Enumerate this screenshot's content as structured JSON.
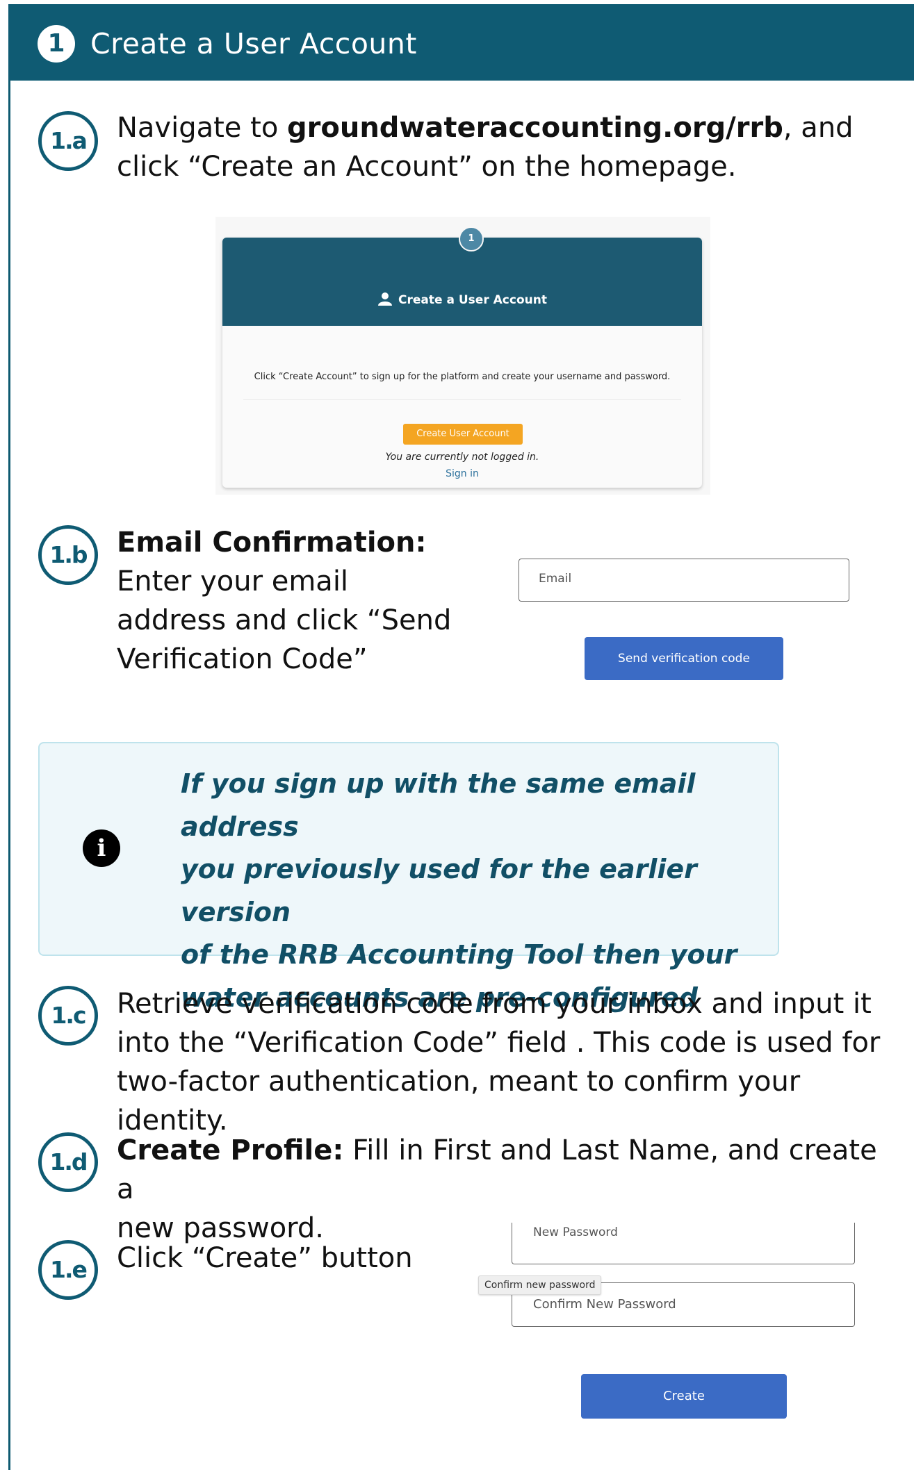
{
  "header": {
    "step_number": "1",
    "title": "Create a User Account"
  },
  "steps": {
    "a": {
      "badge": "1.a",
      "text_pre": "Navigate to ",
      "url": "groundwateraccounting.org/rrb",
      "text_post": ", and click “Create an Account” on the homepage."
    },
    "b": {
      "badge": "1.b",
      "heading": "Email Confirmation:",
      "line1": "Enter your email",
      "line2": "address and click “Send",
      "line3": "Verification Code”"
    },
    "c": {
      "badge": "1.c",
      "line1": "Retrieve verification code from your inbox and input it",
      "line2": "into the “Verification Code” field . This code is used for",
      "line3": "two-factor authentication, meant to confirm your identity."
    },
    "d": {
      "badge": "1.d",
      "heading": "Create Profile:",
      "text1": " Fill in First and Last Name, and create a",
      "text2": "new password."
    },
    "e": {
      "badge": "1.e",
      "text": "Click “Create” button"
    }
  },
  "screenshot_1a": {
    "step_number": "1",
    "card_title": "Create a User Account",
    "description": "Click “Create Account” to sign up for the platform and create your username and password.",
    "button_label": "Create User Account",
    "status_note": "You are currently not logged in.",
    "sign_in_link": "Sign in"
  },
  "screenshot_1b": {
    "email_placeholder": "Email",
    "send_button": "Send verification code"
  },
  "info_box": {
    "icon": "info-icon",
    "line1": "If you sign up with the same email address",
    "line2": "you previously used for the earlier version",
    "line3": "of the RRB Accounting Tool then your",
    "line4": "water accounts are pre-configured"
  },
  "screenshot_1e": {
    "new_password_placeholder": "New Password",
    "confirm_tooltip": "Confirm new password",
    "confirm_placeholder": "Confirm New Password",
    "create_button": "Create"
  },
  "colors": {
    "header_bg": "#0f5b73",
    "info_text": "#114f66",
    "button_blue": "#3b6bc5",
    "button_orange": "#f4a522"
  }
}
